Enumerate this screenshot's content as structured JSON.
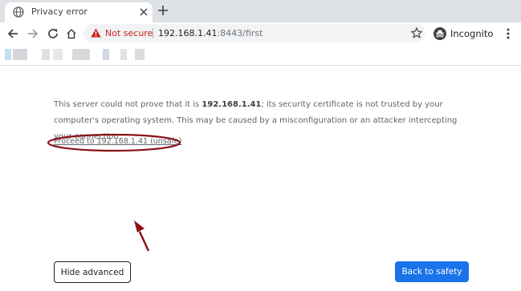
{
  "tab": {
    "title": "Privacy error"
  },
  "toolbar": {
    "security_label": "Not secure",
    "url_host": "192.168.1.41",
    "url_rest": ":8443/first",
    "profile_label": "Incognito"
  },
  "bookmarks": {
    "obscured": true
  },
  "interstitial": {
    "message_prefix": "This server could not prove that it is ",
    "message_host": "192.168.1.41",
    "message_suffix": "; its security certificate is not trusted by your computer's operating system. This may be caused by a misconfiguration or an attacker intercepting your connection.",
    "proceed_link": "Proceed to 192.168.1.41 (unsafe)",
    "hide_advanced_label": "Hide advanced",
    "back_to_safety_label": "Back to safety"
  },
  "colors": {
    "accent_blue": "#1a73e8",
    "warning_red": "#c5221f",
    "annotation_red": "#8b0f14"
  },
  "icons": [
    "globe-icon",
    "close-icon",
    "plus-icon",
    "back-arrow-icon",
    "forward-arrow-icon",
    "reload-icon",
    "home-icon",
    "warning-icon",
    "star-icon",
    "incognito-icon",
    "more-vert-icon"
  ]
}
